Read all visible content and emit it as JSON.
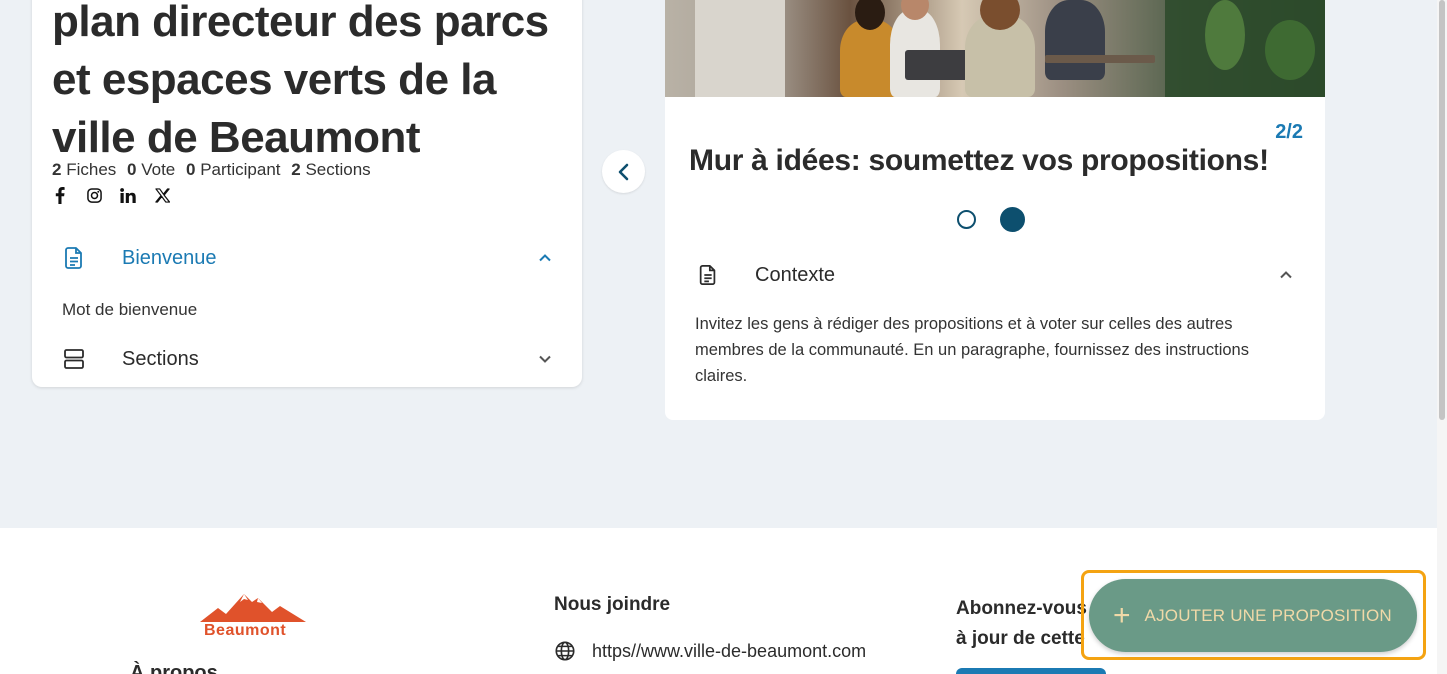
{
  "project": {
    "title_lines": [
      "plan directeur des parcs",
      "et espaces verts de la",
      "ville de Beaumont"
    ],
    "stats": [
      {
        "count": "2",
        "label": "Fiches"
      },
      {
        "count": "0",
        "label": "Vote"
      },
      {
        "count": "0",
        "label": "Participant"
      },
      {
        "count": "2",
        "label": "Sections"
      }
    ],
    "socials": [
      "facebook-icon",
      "instagram-icon",
      "linkedin-icon",
      "x-icon"
    ]
  },
  "accordion": {
    "welcome_label": "Bienvenue",
    "welcome_item": "Mot de bienvenue",
    "sections_label": "Sections"
  },
  "carousel": {
    "counter": "2/2",
    "title": "Mur à idées: soumettez vos propositions!",
    "dots_total": 2,
    "active_dot": 2,
    "context_label": "Contexte",
    "context_text": "Invitez les gens à rédiger des propositions et à voter sur celles des autres membres de la communauté. En un paragraphe, fournissez des instructions claires."
  },
  "footer": {
    "logo_text": "Beaumont",
    "about_heading": "À propos",
    "contact_heading": "Nous joindre",
    "website": "https//www.ville-de-beaumont.com",
    "subscribe_line1": "Abonnez-vous",
    "subscribe_line2": "à jour de cette"
  },
  "fab": {
    "label": "AJOUTER UNE PROPOSITION"
  },
  "colors": {
    "accent": "#1b7ab3",
    "dark_teal": "#0d4f6e",
    "fab_bg": "#6a9a87",
    "fab_text": "#f0d9a8",
    "focus_outline": "#f4a312",
    "logo": "#e0522b"
  }
}
